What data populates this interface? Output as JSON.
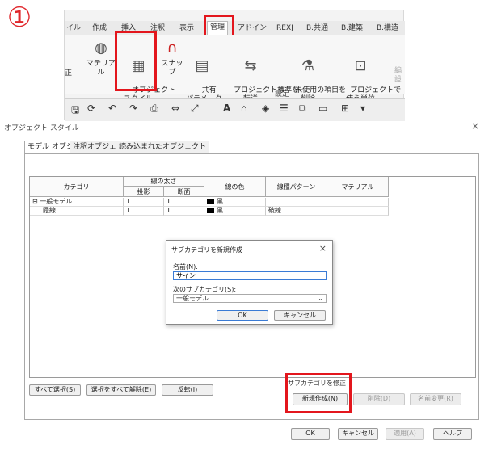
{
  "step_number": "①",
  "ribbon": {
    "tabs": [
      "イル",
      "作成",
      "挿入",
      "注釈",
      "表示",
      "管理",
      "アドイン",
      "REXJ",
      "B.共通",
      "B.建築",
      "B.構造"
    ],
    "active_tab": "管理",
    "tools": [
      {
        "label": "マテリアル",
        "icon": "material-icon"
      },
      {
        "label": "オブジェクト\nスタイル",
        "icon": "object-style-icon"
      },
      {
        "label": "スナップ",
        "icon": "snap-magnet-icon"
      },
      {
        "label": "共有\nパラメータ",
        "icon": "shared-parameters-icon"
      },
      {
        "label": "プロジェクト標準を\n転送",
        "icon": "transfer-standards-icon"
      },
      {
        "label": "未使用の項目を\n削除",
        "icon": "purge-unused-icon"
      },
      {
        "label": "プロジェクトで\n使う単位",
        "icon": "project-units-icon"
      }
    ],
    "left_cut_label": "正",
    "right_cut_label": "編\n設",
    "panel_label": "設定"
  },
  "dialog": {
    "title": "オブジェクト スタイル",
    "close": "×",
    "tabs": [
      "モデル オブジェクト",
      "注釈オブジェクト",
      "読み込まれたオブジェクト"
    ],
    "columns": {
      "category": "カテゴリ",
      "line_weight": "線の太さ",
      "projection": "投影",
      "cut": "断面",
      "line_color": "線の色",
      "line_pattern": "線種パターン",
      "material": "マテリアル"
    },
    "rows": [
      {
        "toggle": "⊟",
        "category": "一般モデル",
        "projection": "1",
        "cut": "1",
        "color": "黒",
        "pattern": "",
        "material": ""
      },
      {
        "toggle": "",
        "category": "隠線",
        "projection": "1",
        "cut": "1",
        "color": "黒",
        "pattern": "破線",
        "material": ""
      }
    ],
    "select_all": "すべて選択(S)",
    "deselect_all": "選択をすべて解除(E)",
    "invert": "反転(I)",
    "modify_group": "サブカテゴリを修正",
    "new_button": "新規作成(N)",
    "delete_button": "削除(D)",
    "rename_button": "名前変更(R)",
    "ok": "OK",
    "cancel": "キャンセル",
    "apply": "適用(A)",
    "help": "ヘルプ"
  },
  "subdialog": {
    "title": "サブカテゴリを新規作成",
    "close": "×",
    "name_label": "名前(N):",
    "name_value": "サイン",
    "parent_label": "次のサブカテゴリ(S):",
    "parent_value": "一般モデル",
    "ok": "OK",
    "cancel": "キャンセル"
  },
  "colors": {
    "highlight": "#e3161d",
    "step": "#e0262b"
  }
}
